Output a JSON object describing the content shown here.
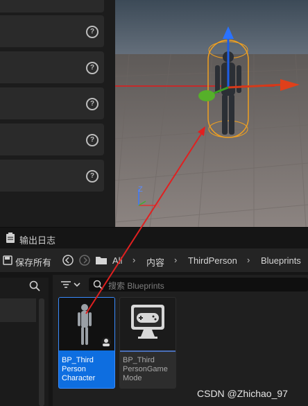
{
  "bottom_panel": {
    "log_tab_label": "输出日志"
  },
  "toolbar": {
    "save_all_label": "保存所有",
    "breadcrumb": [
      "All",
      "内容",
      "ThirdPerson",
      "Blueprints"
    ]
  },
  "content_browser": {
    "search_placeholder": "搜索 Blueprints",
    "assets": [
      {
        "name": "BP_Third\nPerson\nCharacter",
        "selected": true
      },
      {
        "name": "BP_Third\nPersonGame\nMode",
        "selected": false
      }
    ]
  },
  "viewport": {
    "axis_labels": [
      "Z",
      "X"
    ]
  },
  "watermark": "CSDN @Zhichao_97",
  "colors": {
    "selection": "#0e6ee0",
    "arrow": "#e02020"
  }
}
